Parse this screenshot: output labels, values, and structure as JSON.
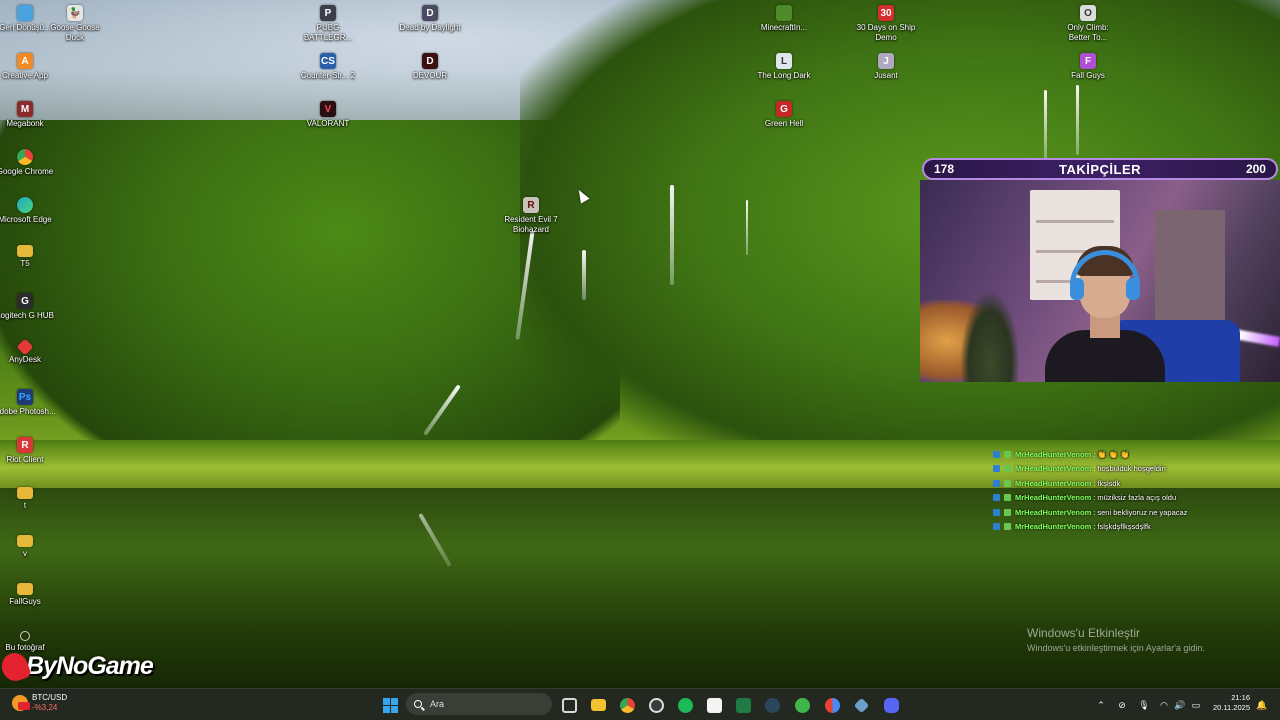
{
  "desktop": {
    "icons": [
      {
        "label": "Geri Dönüşü...",
        "icon": "recycle-bin-icon",
        "color": "#4aa3df"
      },
      {
        "label": "Creative App",
        "icon": "creative-app-icon",
        "color": "#f08a24"
      },
      {
        "label": "Megabonk",
        "icon": "megabonk-icon",
        "color": "#8a2b2b"
      },
      {
        "label": "Google Chrome",
        "icon": "chrome-icon",
        "color": "#e84234"
      },
      {
        "label": "Microsoft Edge",
        "icon": "edge-icon",
        "color": "#1fa8c9"
      },
      {
        "label": "T5",
        "icon": "folder-icon",
        "color": "#e8b83a"
      },
      {
        "label": "Logitech G HUB",
        "icon": "logitech-icon",
        "color": "#2c2c2c"
      },
      {
        "label": "AnyDesk",
        "icon": "anydesk-icon",
        "color": "#e53935"
      },
      {
        "label": "Adobe Photosh...",
        "icon": "photoshop-icon",
        "color": "#1d3a78"
      },
      {
        "label": "Riot Client",
        "icon": "riot-client-icon",
        "color": "#d93838"
      },
      {
        "label": "t",
        "icon": "folder-icon",
        "color": "#e8b83a"
      },
      {
        "label": "v",
        "icon": "folder-icon",
        "color": "#e8b83a"
      },
      {
        "label": "FallGuys",
        "icon": "folder-icon",
        "color": "#e8b83a"
      },
      {
        "label": "Bu fotoğraf",
        "icon": "photo-icon",
        "color": "#555555"
      },
      {
        "label": "Goose Goose Duck",
        "icon": "goose-goose-duck-icon",
        "color": "#e4e4e4"
      },
      {
        "label": "PUBG BATTLEGR...",
        "icon": "pubg-icon",
        "color": "#3b3f4a"
      },
      {
        "label": "Counter-Str... 2",
        "icon": "counter-strike-icon",
        "color": "#2b5fa8"
      },
      {
        "label": "VALORANT",
        "icon": "valorant-icon",
        "color": "#2a0f12"
      },
      {
        "label": "Dead by Daylight",
        "icon": "dead-by-daylight-icon",
        "color": "#4a4a62"
      },
      {
        "label": "DEVOUR",
        "icon": "devour-icon",
        "color": "#3a1010"
      },
      {
        "label": "Resident Evil 7 Biohazard",
        "icon": "resident-evil-icon",
        "color": "#c9c2b8"
      },
      {
        "label": "MinecraftIn...",
        "icon": "minecraft-icon",
        "color": "#4f8a2b"
      },
      {
        "label": "The Long Dark",
        "icon": "the-long-dark-icon",
        "color": "#dfe6ec"
      },
      {
        "label": "Green Hell",
        "icon": "green-hell-icon",
        "color": "#c62828"
      },
      {
        "label": "30 Days on Ship Demo",
        "icon": "30-days-on-ship-icon",
        "color": "#d32f2f"
      },
      {
        "label": "Jusant",
        "icon": "jusant-icon",
        "color": "#b0a7c0"
      },
      {
        "label": "Only Climb: Better To...",
        "icon": "only-climb-icon",
        "color": "#dcdcdc"
      },
      {
        "label": "Fall Guys",
        "icon": "fall-guys-icon",
        "color": "#b04fd6"
      }
    ]
  },
  "overlay": {
    "followers": {
      "current": "178",
      "title": "TAKİPÇİLER",
      "goal": "200",
      "progress_fraction": 0.89
    },
    "chat": [
      {
        "user": "MrHeadHunterVenom",
        "message": "👏 👏 👏"
      },
      {
        "user": "MrHeadHunterVenom",
        "message": "hoşbulduk hoşgeldin"
      },
      {
        "user": "MrHeadHunterVenom",
        "message": "fkşlsdk"
      },
      {
        "user": "MrHeadHunterVenom",
        "message": "müziksiz fazla açış oldu"
      },
      {
        "user": "MrHeadHunterVenom",
        "message": "seni bekliyoruz ne yapacaz"
      },
      {
        "user": "MrHeadHunterVenom",
        "message": "fslşkdşflkşsdşlfk"
      }
    ],
    "logo_text": "ByNoGame"
  },
  "watermark": {
    "line1": "Windows'u Etkinleştir",
    "line2": "Windows'u etkinleştirmek için Ayarlar'a gidin."
  },
  "taskbar": {
    "ticker_name": "BTC/USD",
    "ticker_change": "-%3,24",
    "search_placeholder": "Ara",
    "apps": [
      {
        "name": "task-view-icon",
        "color": "#d8d8d8"
      },
      {
        "name": "file-explorer-icon",
        "color": "#f2c230"
      },
      {
        "name": "chrome-icon",
        "color": "#e84234"
      },
      {
        "name": "obs-icon",
        "color": "#3b3b3b"
      },
      {
        "name": "spotify-icon",
        "color": "#1db954"
      },
      {
        "name": "microsoft-store-icon",
        "color": "#f4f4f4"
      },
      {
        "name": "excel-icon",
        "color": "#1f7a44"
      },
      {
        "name": "steam-icon",
        "color": "#2a475e"
      },
      {
        "name": "xbox-icon",
        "color": "#3fb64a"
      },
      {
        "name": "chrome-profile-icon",
        "color": "#4a8af4"
      },
      {
        "name": "tool-icon",
        "color": "#6aa0c8"
      },
      {
        "name": "discord-icon",
        "color": "#5865f2"
      }
    ],
    "time": "21:16",
    "date": "20.11.2025"
  }
}
